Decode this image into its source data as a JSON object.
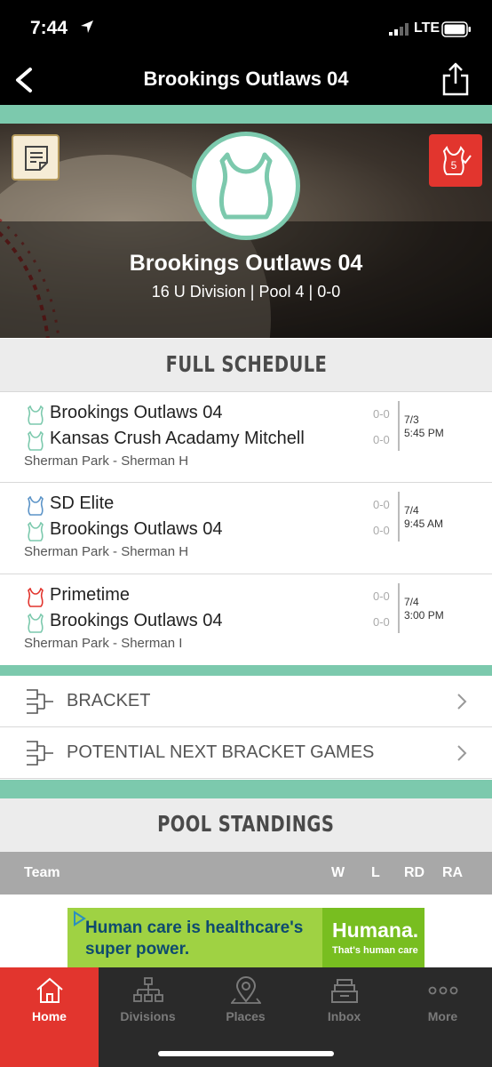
{
  "status_bar": {
    "time": "7:44",
    "network": "LTE"
  },
  "nav": {
    "title": "Brookings Outlaws 04"
  },
  "hero": {
    "team_name": "Brookings Outlaws 04",
    "subtitle": "16 U Division | Pool 4 | 0-0",
    "favorite_count": "5"
  },
  "schedule": {
    "heading": "FULL SCHEDULE",
    "games": [
      {
        "team1": "Brookings Outlaws 04",
        "team1_color": "#7cc9ad",
        "score1": "0-0",
        "team2": "Kansas Crush Acadamy Mitchell",
        "team2_color": "#7cc9ad",
        "score2": "0-0",
        "date": "7/3",
        "time": "5:45 PM",
        "location": "Sherman Park - Sherman H"
      },
      {
        "team1": "SD Elite",
        "team1_color": "#5b93c7",
        "score1": "0-0",
        "team2": "Brookings Outlaws 04",
        "team2_color": "#7cc9ad",
        "score2": "0-0",
        "date": "7/4",
        "time": "9:45 AM",
        "location": "Sherman Park - Sherman H"
      },
      {
        "team1": "Primetime",
        "team1_color": "#e2352e",
        "score1": "0-0",
        "team2": "Brookings Outlaws 04",
        "team2_color": "#7cc9ad",
        "score2": "0-0",
        "date": "7/4",
        "time": "3:00 PM",
        "location": "Sherman Park - Sherman I"
      }
    ]
  },
  "links": {
    "bracket": "BRACKET",
    "potential": "POTENTIAL NEXT BRACKET GAMES"
  },
  "standings": {
    "heading": "POOL STANDINGS",
    "columns": {
      "team": "Team",
      "w": "W",
      "l": "L",
      "rd": "RD",
      "ra": "RA"
    }
  },
  "ad": {
    "line1": "Human care is healthcare's",
    "line2": "super power.",
    "brand": "Humana.",
    "tagline": "That's human care"
  },
  "tabs": {
    "home": "Home",
    "divisions": "Divisions",
    "places": "Places",
    "inbox": "Inbox",
    "more": "More"
  },
  "colors": {
    "accent": "#7cc9ad",
    "brand_red": "#e2352e"
  }
}
